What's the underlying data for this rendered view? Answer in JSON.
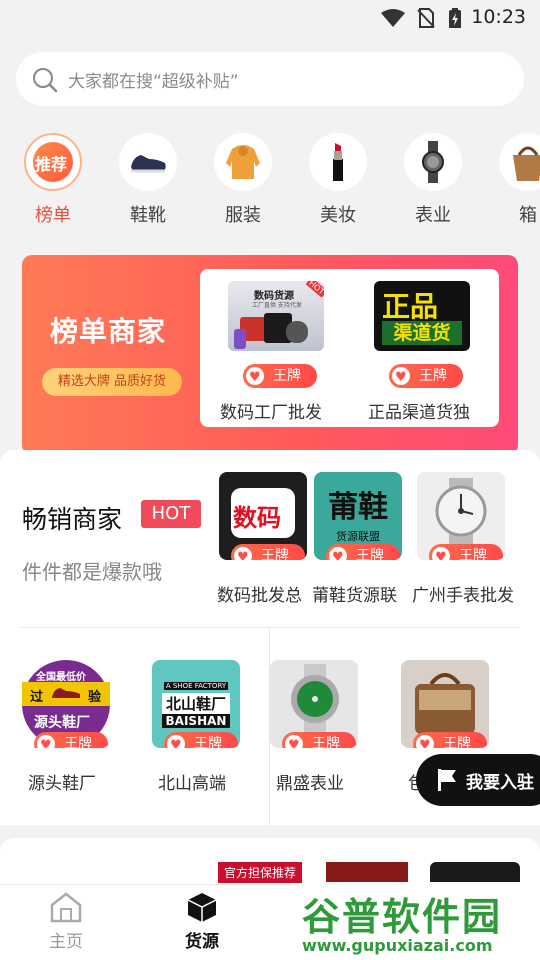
{
  "status_bar": {
    "time": "10:23"
  },
  "search": {
    "placeholder": "大家都在搜“超级补贴”"
  },
  "categories": [
    {
      "label": "榜单",
      "icon": "recommend-badge-icon",
      "badge_text": "推荐",
      "active": true
    },
    {
      "label": "鞋靴",
      "icon": "sneaker-icon"
    },
    {
      "label": "服装",
      "icon": "hoodie-icon"
    },
    {
      "label": "美妆",
      "icon": "lipstick-icon"
    },
    {
      "label": "表业",
      "icon": "watch-icon"
    },
    {
      "label": "箱",
      "icon": "bag-icon"
    }
  ],
  "ranking_banner": {
    "title": "榜单商家",
    "pill": "精选大牌 品质好货",
    "items": [
      {
        "name": "数码工厂批发",
        "thumb_text": "数码货源",
        "thumb_sub": "工厂直供 支持代发",
        "corner": "HOT",
        "badge": "王牌"
      },
      {
        "name": "正品渠道货独",
        "thumb_line1": "正品",
        "thumb_line2": "渠道货",
        "badge": "王牌"
      }
    ]
  },
  "bestseller": {
    "title": "畅销商家",
    "hot": "HOT",
    "subtitle": "件件都是爆款哦",
    "items": [
      {
        "name": "数码批发总",
        "thumb_text": "数码",
        "badge": "王牌"
      },
      {
        "name": "莆鞋货源联",
        "thumb_text": "莆鞋",
        "thumb_sub": "货源联盟",
        "badge": "王牌"
      },
      {
        "name": "广州手表批发",
        "badge": "王牌"
      }
    ]
  },
  "merchants": [
    {
      "name": "源头鞋厂",
      "thumb_top": "全国最低价",
      "thumb_mid_left": "过",
      "thumb_mid_right": "验",
      "thumb_bottom": "源头鞋厂",
      "badge": "王牌"
    },
    {
      "name": "北山高端",
      "thumb_top": "A SHOE FACTORY",
      "thumb_mid": "北山鞋厂",
      "thumb_bottom": "BAISHAN",
      "badge": "王牌"
    },
    {
      "name": "鼎盛表业",
      "badge": "王牌"
    },
    {
      "name": "包",
      "badge": "王牌"
    }
  ],
  "float_button": {
    "label": "我要入驻"
  },
  "next_section": {
    "tag": "官方担保推荐"
  },
  "bottom_nav": [
    {
      "label": "主页",
      "icon": "home-icon",
      "active": false
    },
    {
      "label": "货源",
      "icon": "box-icon",
      "active": true
    }
  ],
  "watermark": {
    "title": "谷普软件园",
    "url": "www.gupuxiazai.com"
  },
  "colors": {
    "accent": "#e8523c",
    "badge": "#ff5a4a",
    "banner_start": "#ff7a55",
    "banner_end": "#ff4a78"
  }
}
